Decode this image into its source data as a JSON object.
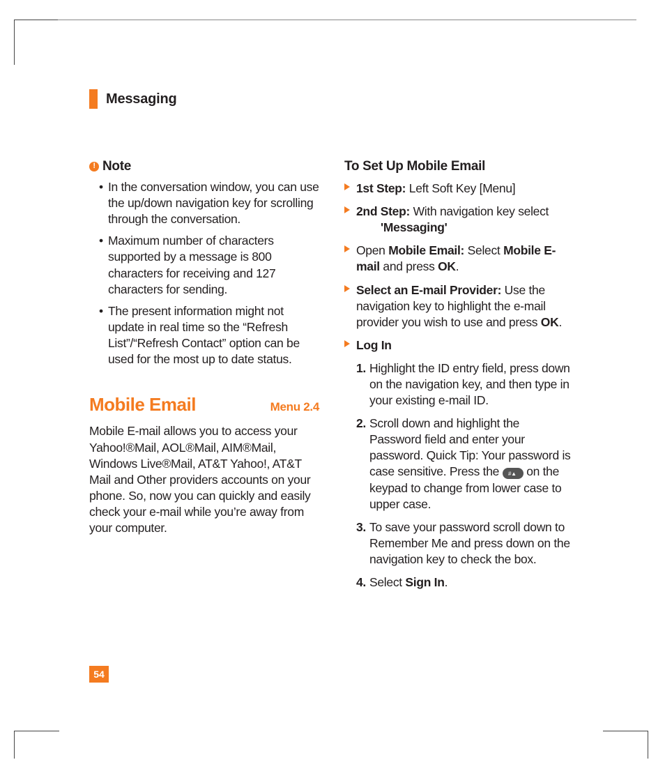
{
  "header": {
    "title": "Messaging"
  },
  "note": {
    "label": "Note",
    "bullets": [
      "In the conversation window, you can use the up/down navigation key for scrolling through the conversation.",
      "Maximum number of characters supported by a message is 800 characters for receiving and 127 characters for sending.",
      "The present information might not update in real time so the “Refresh List”/“Refresh Contact” option can be used for the most up to date status."
    ]
  },
  "section": {
    "title": "Mobile Email",
    "menu": "Menu 2.4",
    "body": "Mobile  E-mail allows you to access your Yahoo!®Mail, AOL®Mail, AIM®Mail, Windows Live®Mail, AT&T Yahoo!, AT&T Mail and Other providers accounts on your phone. So, now you can quickly and easily check your e-mail while you’re away from your computer."
  },
  "setup": {
    "heading": "To Set Up Mobile Email",
    "step1_label": "1st Step:",
    "step1_text": " Left Soft Key [Menu]",
    "step2_label": "2nd Step:",
    "step2_text": " With navigation key select ",
    "step2_bold": "'Messaging'",
    "open_pre": "Open ",
    "open_bold1": "Mobile Email:",
    "open_mid": " Select ",
    "open_bold2": "Mobile E-mail",
    "open_mid2": " and press ",
    "open_bold3": "OK",
    "open_post": ".",
    "select_label": "Select an  E-mail Provider:",
    "select_text_a": " Use the navigation key to highlight the e-mail provider you wish to use and press ",
    "select_ok": "OK",
    "select_text_b": ".",
    "login_label": "Log In",
    "n1": "1.",
    "t1": "Highlight the ID entry field, press down on the navigation key, and then type in your existing e-mail ID.",
    "n2": "2.",
    "t2a": "Scroll down and highlight the Password field and enter your password. Quick Tip: Your password is case sensitive. Press the ",
    "t2b": " on the keypad to change from lower case to upper case.",
    "n3": "3.",
    "t3": "To save your password scroll down to Remember Me and press down on the navigation key to check the box.",
    "n4": "4.",
    "t4a": "Select ",
    "t4b": "Sign In",
    "t4c": "."
  },
  "page_number": "54"
}
